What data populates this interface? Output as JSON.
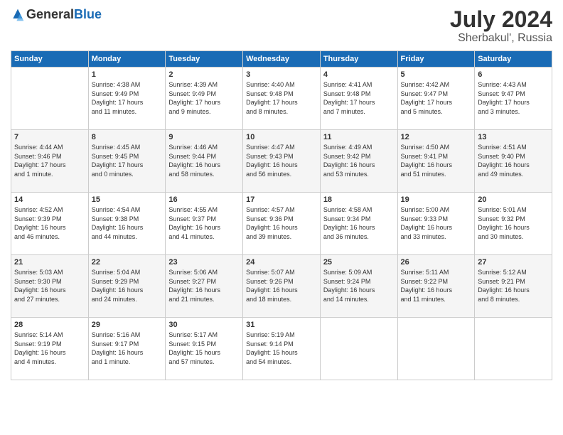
{
  "header": {
    "logo_general": "General",
    "logo_blue": "Blue",
    "month_year": "July 2024",
    "location": "Sherbakul', Russia"
  },
  "days_of_week": [
    "Sunday",
    "Monday",
    "Tuesday",
    "Wednesday",
    "Thursday",
    "Friday",
    "Saturday"
  ],
  "weeks": [
    [
      {
        "day": "",
        "info": ""
      },
      {
        "day": "1",
        "info": "Sunrise: 4:38 AM\nSunset: 9:49 PM\nDaylight: 17 hours\nand 11 minutes."
      },
      {
        "day": "2",
        "info": "Sunrise: 4:39 AM\nSunset: 9:49 PM\nDaylight: 17 hours\nand 9 minutes."
      },
      {
        "day": "3",
        "info": "Sunrise: 4:40 AM\nSunset: 9:48 PM\nDaylight: 17 hours\nand 8 minutes."
      },
      {
        "day": "4",
        "info": "Sunrise: 4:41 AM\nSunset: 9:48 PM\nDaylight: 17 hours\nand 7 minutes."
      },
      {
        "day": "5",
        "info": "Sunrise: 4:42 AM\nSunset: 9:47 PM\nDaylight: 17 hours\nand 5 minutes."
      },
      {
        "day": "6",
        "info": "Sunrise: 4:43 AM\nSunset: 9:47 PM\nDaylight: 17 hours\nand 3 minutes."
      }
    ],
    [
      {
        "day": "7",
        "info": "Sunrise: 4:44 AM\nSunset: 9:46 PM\nDaylight: 17 hours\nand 1 minute."
      },
      {
        "day": "8",
        "info": "Sunrise: 4:45 AM\nSunset: 9:45 PM\nDaylight: 17 hours\nand 0 minutes."
      },
      {
        "day": "9",
        "info": "Sunrise: 4:46 AM\nSunset: 9:44 PM\nDaylight: 16 hours\nand 58 minutes."
      },
      {
        "day": "10",
        "info": "Sunrise: 4:47 AM\nSunset: 9:43 PM\nDaylight: 16 hours\nand 56 minutes."
      },
      {
        "day": "11",
        "info": "Sunrise: 4:49 AM\nSunset: 9:42 PM\nDaylight: 16 hours\nand 53 minutes."
      },
      {
        "day": "12",
        "info": "Sunrise: 4:50 AM\nSunset: 9:41 PM\nDaylight: 16 hours\nand 51 minutes."
      },
      {
        "day": "13",
        "info": "Sunrise: 4:51 AM\nSunset: 9:40 PM\nDaylight: 16 hours\nand 49 minutes."
      }
    ],
    [
      {
        "day": "14",
        "info": "Sunrise: 4:52 AM\nSunset: 9:39 PM\nDaylight: 16 hours\nand 46 minutes."
      },
      {
        "day": "15",
        "info": "Sunrise: 4:54 AM\nSunset: 9:38 PM\nDaylight: 16 hours\nand 44 minutes."
      },
      {
        "day": "16",
        "info": "Sunrise: 4:55 AM\nSunset: 9:37 PM\nDaylight: 16 hours\nand 41 minutes."
      },
      {
        "day": "17",
        "info": "Sunrise: 4:57 AM\nSunset: 9:36 PM\nDaylight: 16 hours\nand 39 minutes."
      },
      {
        "day": "18",
        "info": "Sunrise: 4:58 AM\nSunset: 9:34 PM\nDaylight: 16 hours\nand 36 minutes."
      },
      {
        "day": "19",
        "info": "Sunrise: 5:00 AM\nSunset: 9:33 PM\nDaylight: 16 hours\nand 33 minutes."
      },
      {
        "day": "20",
        "info": "Sunrise: 5:01 AM\nSunset: 9:32 PM\nDaylight: 16 hours\nand 30 minutes."
      }
    ],
    [
      {
        "day": "21",
        "info": "Sunrise: 5:03 AM\nSunset: 9:30 PM\nDaylight: 16 hours\nand 27 minutes."
      },
      {
        "day": "22",
        "info": "Sunrise: 5:04 AM\nSunset: 9:29 PM\nDaylight: 16 hours\nand 24 minutes."
      },
      {
        "day": "23",
        "info": "Sunrise: 5:06 AM\nSunset: 9:27 PM\nDaylight: 16 hours\nand 21 minutes."
      },
      {
        "day": "24",
        "info": "Sunrise: 5:07 AM\nSunset: 9:26 PM\nDaylight: 16 hours\nand 18 minutes."
      },
      {
        "day": "25",
        "info": "Sunrise: 5:09 AM\nSunset: 9:24 PM\nDaylight: 16 hours\nand 14 minutes."
      },
      {
        "day": "26",
        "info": "Sunrise: 5:11 AM\nSunset: 9:22 PM\nDaylight: 16 hours\nand 11 minutes."
      },
      {
        "day": "27",
        "info": "Sunrise: 5:12 AM\nSunset: 9:21 PM\nDaylight: 16 hours\nand 8 minutes."
      }
    ],
    [
      {
        "day": "28",
        "info": "Sunrise: 5:14 AM\nSunset: 9:19 PM\nDaylight: 16 hours\nand 4 minutes."
      },
      {
        "day": "29",
        "info": "Sunrise: 5:16 AM\nSunset: 9:17 PM\nDaylight: 16 hours\nand 1 minute."
      },
      {
        "day": "30",
        "info": "Sunrise: 5:17 AM\nSunset: 9:15 PM\nDaylight: 15 hours\nand 57 minutes."
      },
      {
        "day": "31",
        "info": "Sunrise: 5:19 AM\nSunset: 9:14 PM\nDaylight: 15 hours\nand 54 minutes."
      },
      {
        "day": "",
        "info": ""
      },
      {
        "day": "",
        "info": ""
      },
      {
        "day": "",
        "info": ""
      }
    ]
  ]
}
